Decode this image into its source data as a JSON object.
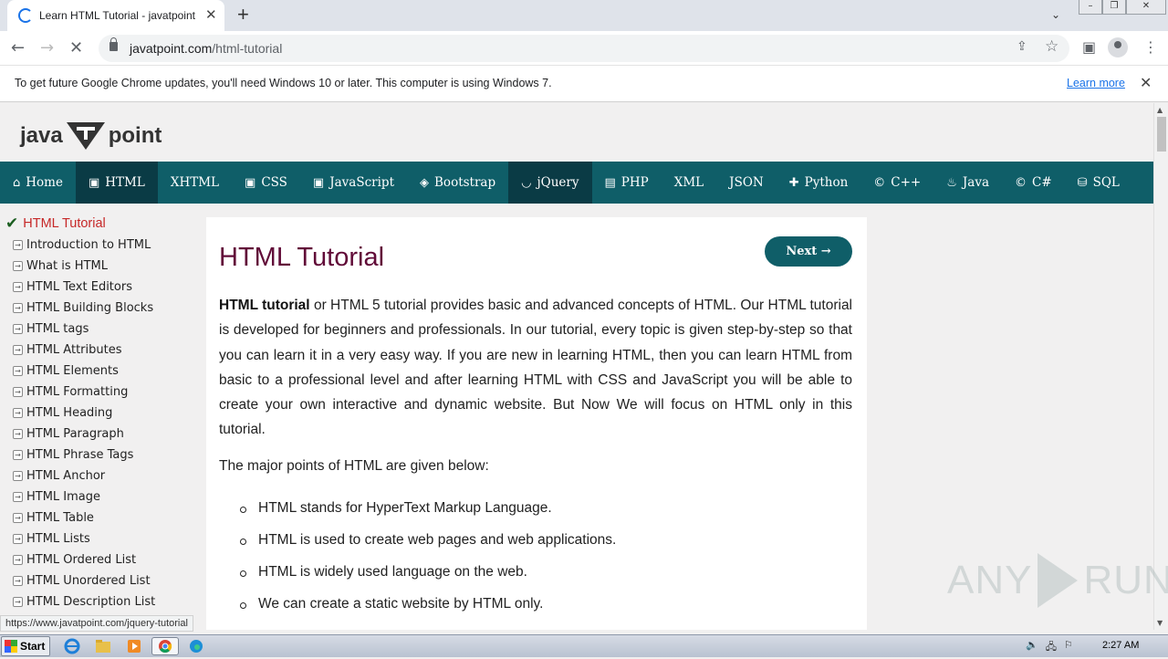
{
  "browser": {
    "tab_title": "Learn HTML Tutorial - javatpoint",
    "tab_close": "✕",
    "new_tab": "+",
    "url_domain": "javatpoint.com",
    "url_path": "/html-tutorial",
    "status_url": "https://www.javatpoint.com/jquery-tutorial"
  },
  "infobar": {
    "message": "To get future Google Chrome updates, you'll need Windows 10 or later. This computer is using Windows 7.",
    "learn_more": "Learn more"
  },
  "site": {
    "logo_left": "java",
    "logo_right": "point",
    "brand_color": "#0f5e68",
    "nav": [
      {
        "label": "Home",
        "icon": "home-icon",
        "glyph": "⌂",
        "active": false
      },
      {
        "label": "HTML",
        "icon": "html5-icon",
        "glyph": "▣",
        "active": true
      },
      {
        "label": "XHTML",
        "icon": "",
        "glyph": "",
        "active": false
      },
      {
        "label": "CSS",
        "icon": "css3-icon",
        "glyph": "▣",
        "active": false
      },
      {
        "label": "JavaScript",
        "icon": "js-icon",
        "glyph": "▣",
        "active": false
      },
      {
        "label": "Bootstrap",
        "icon": "bootstrap-icon",
        "glyph": "◈",
        "active": false
      },
      {
        "label": "jQuery",
        "icon": "jquery-icon",
        "glyph": "◡",
        "active": true
      },
      {
        "label": "PHP",
        "icon": "php-icon",
        "glyph": "▤",
        "active": false
      },
      {
        "label": "XML",
        "icon": "",
        "glyph": "",
        "active": false
      },
      {
        "label": "JSON",
        "icon": "",
        "glyph": "",
        "active": false
      },
      {
        "label": "Python",
        "icon": "python-icon",
        "glyph": "✚",
        "active": false
      },
      {
        "label": "C++",
        "icon": "cpp-icon",
        "glyph": "©",
        "active": false
      },
      {
        "label": "Java",
        "icon": "java-icon",
        "glyph": "♨",
        "active": false
      },
      {
        "label": "C#",
        "icon": "csharp-icon",
        "glyph": "©",
        "active": false
      },
      {
        "label": "SQL",
        "icon": "sql-icon",
        "glyph": "⛁",
        "active": false
      }
    ]
  },
  "sidebar": {
    "heading": "HTML Tutorial",
    "items": [
      "Introduction to HTML",
      "What is HTML",
      "HTML Text Editors",
      "HTML Building Blocks",
      "HTML tags",
      "HTML Attributes",
      "HTML Elements",
      "HTML Formatting",
      "HTML Heading",
      "HTML Paragraph",
      "HTML Phrase Tags",
      "HTML Anchor",
      "HTML Image",
      "HTML Table",
      "HTML Lists",
      "HTML Ordered List",
      "HTML Unordered List",
      "HTML Description List"
    ]
  },
  "article": {
    "title": "HTML Tutorial",
    "next_label": "Next →",
    "intro_bold": "HTML tutorial",
    "intro_rest": " or HTML 5 tutorial provides basic and advanced concepts of HTML. Our HTML tutorial is developed for beginners and professionals. In our tutorial, every topic is given step-by-step so that you can learn it in a very easy way. If you are new in learning HTML, then you can learn HTML from basic to a professional level and after learning HTML with CSS and JavaScript you will be able to create your own interactive and dynamic website. But Now We will focus on HTML only in this tutorial.",
    "points_intro": "The major points of HTML are given below:",
    "points": [
      "HTML stands for HyperText Markup Language.",
      "HTML is used to create web pages and web applications.",
      "HTML is widely used language on the web.",
      "We can create a static website by HTML only."
    ]
  },
  "watermark": {
    "left": "ANY",
    "right": "RUN"
  },
  "taskbar": {
    "start": "Start",
    "clock": "2:27 AM"
  }
}
